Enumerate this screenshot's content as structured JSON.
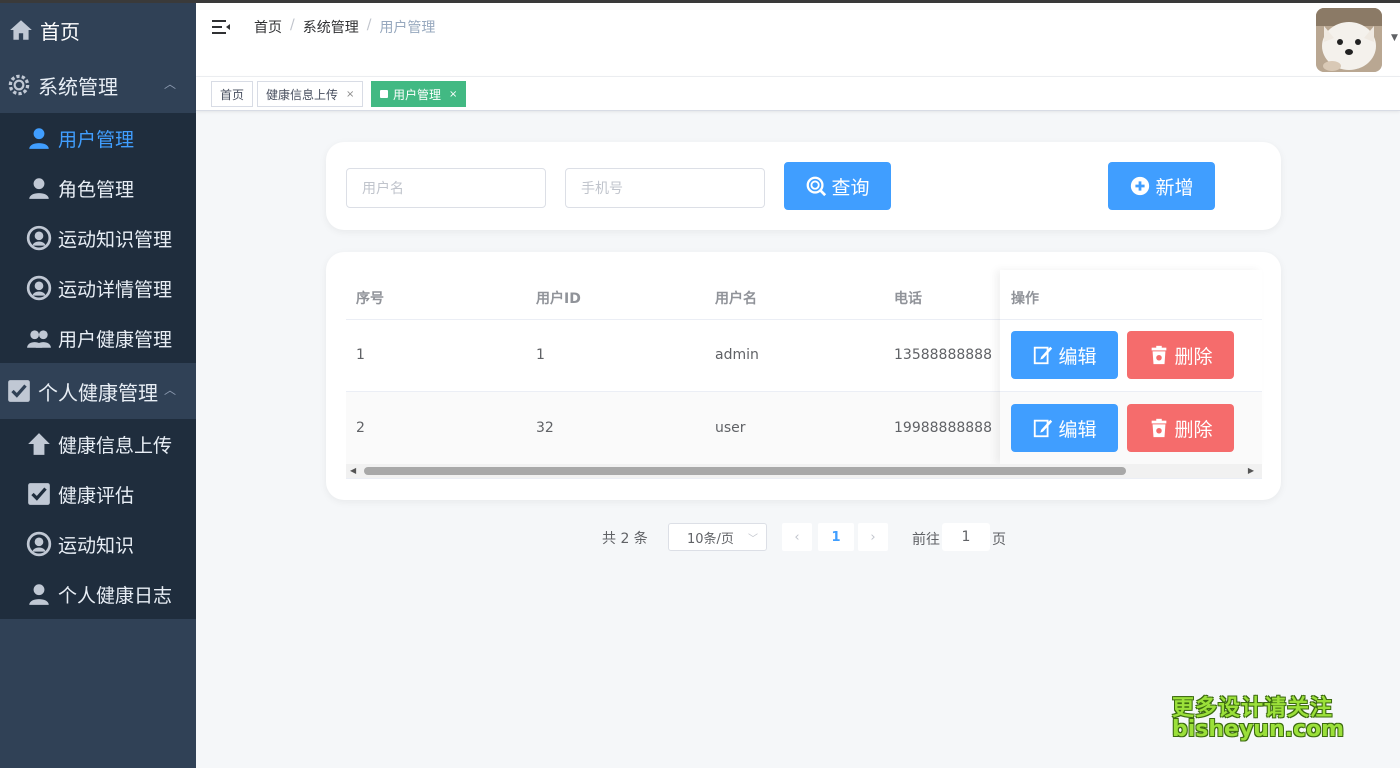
{
  "sidebar": {
    "home": "首页",
    "groups": [
      {
        "label": "系统管理",
        "items": [
          {
            "label": "用户管理",
            "active": true
          },
          {
            "label": "角色管理"
          },
          {
            "label": "运动知识管理"
          },
          {
            "label": "运动详情管理"
          },
          {
            "label": "用户健康管理"
          }
        ]
      },
      {
        "label": "个人健康管理",
        "items": [
          {
            "label": "健康信息上传"
          },
          {
            "label": "健康评估"
          },
          {
            "label": "运动知识"
          },
          {
            "label": "个人健康日志"
          }
        ]
      }
    ]
  },
  "breadcrumb": [
    "首页",
    "系统管理",
    "用户管理"
  ],
  "tags": [
    {
      "label": "首页"
    },
    {
      "label": "健康信息上传",
      "close": "×"
    },
    {
      "label": "用户管理",
      "close": "×",
      "active": true
    }
  ],
  "search": {
    "username_placeholder": "用户名",
    "phone_placeholder": "手机号",
    "query_label": "查询",
    "add_label": "新增"
  },
  "table": {
    "headers": [
      "序号",
      "用户ID",
      "用户名",
      "电话",
      "操作"
    ],
    "rows": [
      {
        "index": "1",
        "id": "1",
        "username": "admin",
        "phone": "13588888888"
      },
      {
        "index": "2",
        "id": "32",
        "username": "user",
        "phone": "19988888888"
      }
    ],
    "edit_label": "编辑",
    "delete_label": "删除"
  },
  "pagination": {
    "total": "共 2 条",
    "page_size": "10条/页",
    "current_page": "1",
    "goto_label": "前往",
    "goto_value": "1",
    "page_suffix": "页"
  },
  "watermark": {
    "line1": "更多设计请关注",
    "line2": "bisheyun.com"
  },
  "colors": {
    "sidebar_bg": "#304156",
    "submenu_bg": "#1f2d3d",
    "primary": "#409eff",
    "danger": "#f56c6c",
    "tag_active": "#42b983"
  }
}
